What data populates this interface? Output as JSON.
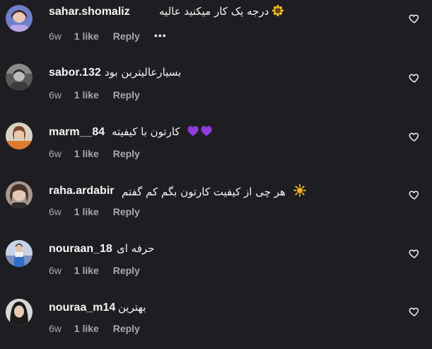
{
  "comments": [
    {
      "username": "sahar.shomaliz",
      "text": "درجه یک کار میکنید عالیه",
      "emoji": "sunflower",
      "time": "6w",
      "likes": "1 like",
      "reply": "Reply",
      "more": "•••"
    },
    {
      "username": "sabor.132",
      "text": "بسیارعالیتربن بود",
      "emoji": "",
      "time": "6w",
      "likes": "1 like",
      "reply": "Reply"
    },
    {
      "username": "marm__84",
      "text": "کارتون با کیفیته",
      "emoji": "purple-hearts",
      "time": "6w",
      "likes": "1 like",
      "reply": "Reply"
    },
    {
      "username": "raha.ardabir",
      "text": "هر چی از کیفیت کارتون بگم کم گفتم",
      "emoji": "sun",
      "time": "6w",
      "likes": "1 like",
      "reply": "Reply"
    },
    {
      "username": "nouraan_18",
      "text": "حرفه ای",
      "emoji": "",
      "time": "6w",
      "likes": "1 like",
      "reply": "Reply"
    },
    {
      "username": "nouraa_m14",
      "text": "بهترین",
      "emoji": "",
      "time": "6w",
      "likes": "1 like",
      "reply": "Reply"
    }
  ],
  "colors": {
    "background": "#1e1e22",
    "primary_text": "#f5f5f5",
    "secondary_text": "#a8a8ad",
    "heart_outline": "#f5f5f5",
    "purple_heart": "#8e3bd9",
    "sunflower_yellow": "#f5c518"
  },
  "icons": {
    "like": "heart-outline-icon",
    "more": "more-options-icon"
  }
}
